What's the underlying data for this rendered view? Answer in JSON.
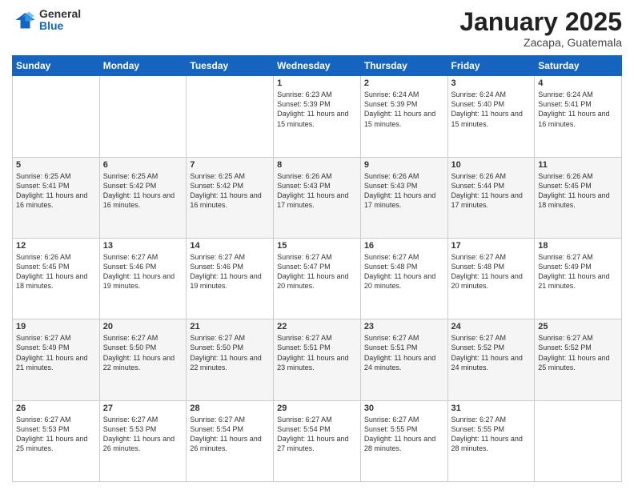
{
  "header": {
    "logo_general": "General",
    "logo_blue": "Blue",
    "title": "January 2025",
    "location": "Zacapa, Guatemala"
  },
  "days_of_week": [
    "Sunday",
    "Monday",
    "Tuesday",
    "Wednesday",
    "Thursday",
    "Friday",
    "Saturday"
  ],
  "weeks": [
    [
      {
        "day": "",
        "content": ""
      },
      {
        "day": "",
        "content": ""
      },
      {
        "day": "",
        "content": ""
      },
      {
        "day": "1",
        "content": "Sunrise: 6:23 AM\nSunset: 5:39 PM\nDaylight: 11 hours\nand 15 minutes."
      },
      {
        "day": "2",
        "content": "Sunrise: 6:24 AM\nSunset: 5:39 PM\nDaylight: 11 hours\nand 15 minutes."
      },
      {
        "day": "3",
        "content": "Sunrise: 6:24 AM\nSunset: 5:40 PM\nDaylight: 11 hours\nand 15 minutes."
      },
      {
        "day": "4",
        "content": "Sunrise: 6:24 AM\nSunset: 5:41 PM\nDaylight: 11 hours\nand 16 minutes."
      }
    ],
    [
      {
        "day": "5",
        "content": "Sunrise: 6:25 AM\nSunset: 5:41 PM\nDaylight: 11 hours\nand 16 minutes."
      },
      {
        "day": "6",
        "content": "Sunrise: 6:25 AM\nSunset: 5:42 PM\nDaylight: 11 hours\nand 16 minutes."
      },
      {
        "day": "7",
        "content": "Sunrise: 6:25 AM\nSunset: 5:42 PM\nDaylight: 11 hours\nand 16 minutes."
      },
      {
        "day": "8",
        "content": "Sunrise: 6:26 AM\nSunset: 5:43 PM\nDaylight: 11 hours\nand 17 minutes."
      },
      {
        "day": "9",
        "content": "Sunrise: 6:26 AM\nSunset: 5:43 PM\nDaylight: 11 hours\nand 17 minutes."
      },
      {
        "day": "10",
        "content": "Sunrise: 6:26 AM\nSunset: 5:44 PM\nDaylight: 11 hours\nand 17 minutes."
      },
      {
        "day": "11",
        "content": "Sunrise: 6:26 AM\nSunset: 5:45 PM\nDaylight: 11 hours\nand 18 minutes."
      }
    ],
    [
      {
        "day": "12",
        "content": "Sunrise: 6:26 AM\nSunset: 5:45 PM\nDaylight: 11 hours\nand 18 minutes."
      },
      {
        "day": "13",
        "content": "Sunrise: 6:27 AM\nSunset: 5:46 PM\nDaylight: 11 hours\nand 19 minutes."
      },
      {
        "day": "14",
        "content": "Sunrise: 6:27 AM\nSunset: 5:46 PM\nDaylight: 11 hours\nand 19 minutes."
      },
      {
        "day": "15",
        "content": "Sunrise: 6:27 AM\nSunset: 5:47 PM\nDaylight: 11 hours\nand 20 minutes."
      },
      {
        "day": "16",
        "content": "Sunrise: 6:27 AM\nSunset: 5:48 PM\nDaylight: 11 hours\nand 20 minutes."
      },
      {
        "day": "17",
        "content": "Sunrise: 6:27 AM\nSunset: 5:48 PM\nDaylight: 11 hours\nand 20 minutes."
      },
      {
        "day": "18",
        "content": "Sunrise: 6:27 AM\nSunset: 5:49 PM\nDaylight: 11 hours\nand 21 minutes."
      }
    ],
    [
      {
        "day": "19",
        "content": "Sunrise: 6:27 AM\nSunset: 5:49 PM\nDaylight: 11 hours\nand 21 minutes."
      },
      {
        "day": "20",
        "content": "Sunrise: 6:27 AM\nSunset: 5:50 PM\nDaylight: 11 hours\nand 22 minutes."
      },
      {
        "day": "21",
        "content": "Sunrise: 6:27 AM\nSunset: 5:50 PM\nDaylight: 11 hours\nand 22 minutes."
      },
      {
        "day": "22",
        "content": "Sunrise: 6:27 AM\nSunset: 5:51 PM\nDaylight: 11 hours\nand 23 minutes."
      },
      {
        "day": "23",
        "content": "Sunrise: 6:27 AM\nSunset: 5:51 PM\nDaylight: 11 hours\nand 24 minutes."
      },
      {
        "day": "24",
        "content": "Sunrise: 6:27 AM\nSunset: 5:52 PM\nDaylight: 11 hours\nand 24 minutes."
      },
      {
        "day": "25",
        "content": "Sunrise: 6:27 AM\nSunset: 5:52 PM\nDaylight: 11 hours\nand 25 minutes."
      }
    ],
    [
      {
        "day": "26",
        "content": "Sunrise: 6:27 AM\nSunset: 5:53 PM\nDaylight: 11 hours\nand 25 minutes."
      },
      {
        "day": "27",
        "content": "Sunrise: 6:27 AM\nSunset: 5:53 PM\nDaylight: 11 hours\nand 26 minutes."
      },
      {
        "day": "28",
        "content": "Sunrise: 6:27 AM\nSunset: 5:54 PM\nDaylight: 11 hours\nand 26 minutes."
      },
      {
        "day": "29",
        "content": "Sunrise: 6:27 AM\nSunset: 5:54 PM\nDaylight: 11 hours\nand 27 minutes."
      },
      {
        "day": "30",
        "content": "Sunrise: 6:27 AM\nSunset: 5:55 PM\nDaylight: 11 hours\nand 28 minutes."
      },
      {
        "day": "31",
        "content": "Sunrise: 6:27 AM\nSunset: 5:55 PM\nDaylight: 11 hours\nand 28 minutes."
      },
      {
        "day": "",
        "content": ""
      }
    ]
  ]
}
